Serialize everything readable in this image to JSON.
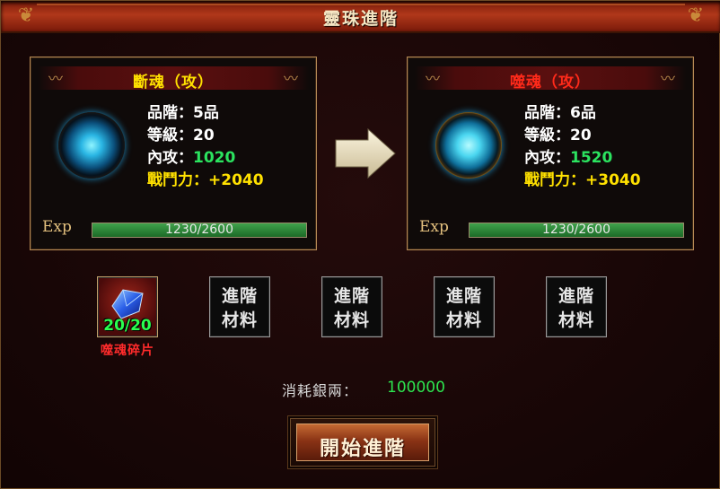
{
  "window": {
    "title": "靈珠進階"
  },
  "current": {
    "name": "斷魂（攻）",
    "name_color": "#ffe100",
    "grade": "品階：5品",
    "level": "等級：20",
    "attack_label": "內攻：",
    "attack_value": "1020",
    "power": "戰鬥力：+2040",
    "exp_label": "Exp",
    "exp_text": "1230/2600",
    "exp_fraction": 1.0
  },
  "next": {
    "name": "噬魂（攻）",
    "name_color": "#ff2a1a",
    "grade": "品階：6品",
    "level": "等級：20",
    "attack_label": "內攻：",
    "attack_value": "1520",
    "power": "戰鬥力：+3040",
    "exp_label": "Exp",
    "exp_text": "1230/2600",
    "exp_fraction": 1.0
  },
  "materials": {
    "item": {
      "count": "20/20",
      "name": "噬魂碎片"
    },
    "empty_slots": [
      {
        "line1": "進階",
        "line2": "材料"
      },
      {
        "line1": "進階",
        "line2": "材料"
      },
      {
        "line1": "進階",
        "line2": "材料"
      },
      {
        "line1": "進階",
        "line2": "材料"
      }
    ]
  },
  "cost": {
    "label": "消耗銀兩：",
    "value": "100000"
  },
  "action": {
    "label": "開始進階"
  },
  "icons": {
    "arrow": "right-arrow-icon",
    "orb_current": "orb-icon",
    "orb_next": "orb-upgraded-icon",
    "gem": "blue-gem-icon"
  }
}
